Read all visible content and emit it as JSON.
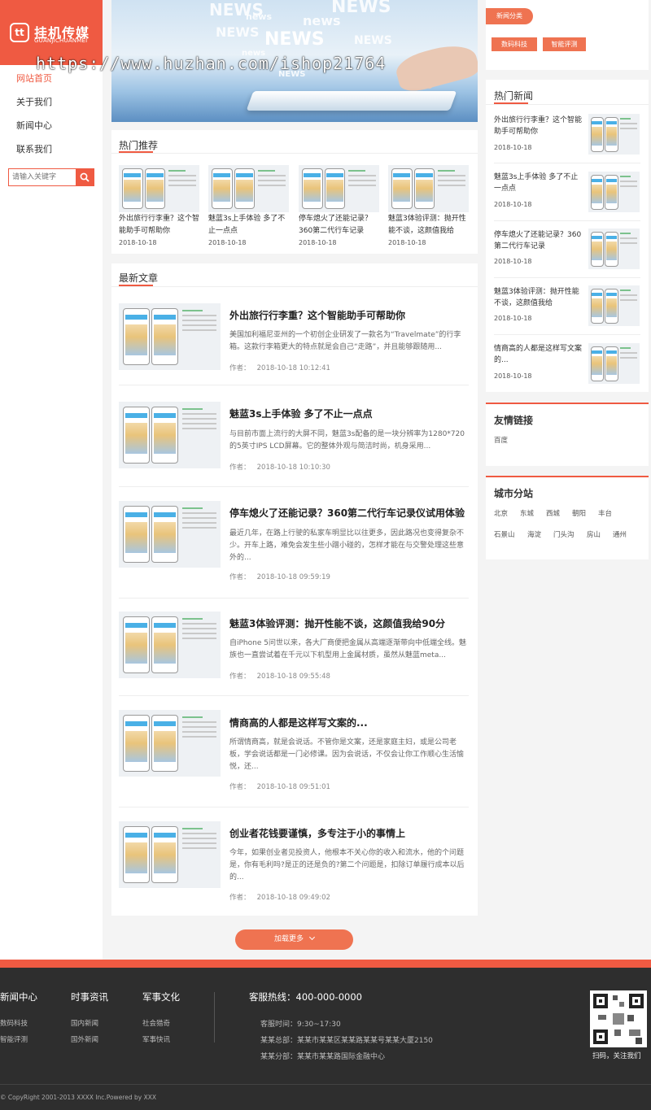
{
  "brand": {
    "name": "挂机传媒",
    "subtitle": "GUANJICHUANMEI",
    "mark": "tt"
  },
  "watermark_url": "https://www.huzhan.com/ishop21764",
  "nav": [
    {
      "label": "网站首页",
      "active": true
    },
    {
      "label": "关于我们",
      "active": false
    },
    {
      "label": "新闻中心",
      "active": false
    },
    {
      "label": "联系我们",
      "active": false
    }
  ],
  "search": {
    "placeholder": "请输入关键字"
  },
  "banner": {
    "words": [
      "NEWS",
      "NEWS",
      "news",
      "news",
      "NEWS",
      "NEWS",
      "NEWS",
      "news",
      "NEWS"
    ]
  },
  "hot": {
    "title": "热门推荐",
    "items": [
      {
        "title": "外出旅行行李重？这个智能助手可帮助你",
        "date": "2018-10-18"
      },
      {
        "title": "魅蓝3s上手体验 多了不止一点点",
        "date": "2018-10-18"
      },
      {
        "title": "停车熄火了还能记录？360第二代行车记录",
        "date": "2018-10-18"
      },
      {
        "title": "魅蓝3体验评测：抛开性能不谈，这颜值我给",
        "date": "2018-10-18"
      }
    ]
  },
  "latest": {
    "title": "最新文章",
    "meta_prefix": "作者：",
    "articles": [
      {
        "title": "外出旅行行李重？这个智能助手可帮助你",
        "excerpt": "美国加利福尼亚州的一个初创企业研发了一款名为“Travelmate”的行李箱。这款行李箱更大的特点就是会自己“走路”，并且能够跟随用...",
        "date": "2018-10-18 10:12:41"
      },
      {
        "title": "魅蓝3s上手体验 多了不止一点点",
        "excerpt": "与目前市面上流行的大屏不同，魅蓝3s配备的是一块分辨率为1280*720的5英寸IPS LCD屏幕。它的整体外观与简洁时尚，机身采用...",
        "date": "2018-10-18 10:10:30"
      },
      {
        "title": "停车熄火了还能记录？360第二代行车记录仪试用体验",
        "excerpt": "最近几年，在路上行驶的私家车明显比以往更多，因此路况也变得复杂不少。开车上路，难免会发生些小蹭小碰的，怎样才能在与交警处理这些意外的...",
        "date": "2018-10-18 09:59:19"
      },
      {
        "title": "魅蓝3体验评测：抛开性能不谈，这颜值我给90分",
        "excerpt": "自iPhone 5问世以来，各大厂商便把金属从高端逐渐带向中低端全线。魅族也一直尝试着在千元以下机型用上金属材质，虽然从魅蓝meta...",
        "date": "2018-10-18 09:55:48"
      },
      {
        "title": "情商高的人都是这样写文案的...",
        "excerpt": "所谓情商高，就是会说话。不管你是文案，还是家庭主妇，或是公司老板，学会说话都是一门必修课。因为会说话，不仅会让你工作顺心生活愉悦，还...",
        "date": "2018-10-18 09:51:01"
      },
      {
        "title": "创业者花钱要谨慎，多专注于小的事情上",
        "excerpt": "今年，如果创业者见投资人，他根本不关心你的收入和流水，他的个问题是，你有毛利吗?是正的还是负的?第二个问题是，扣除订单履行成本以后的...",
        "date": "2018-10-18 09:49:02"
      }
    ],
    "load_more": "加载更多"
  },
  "categories": {
    "title": "新闻分类",
    "tags": [
      "数码科技",
      "智能评测"
    ]
  },
  "hot_news": {
    "title": "热门新闻",
    "items": [
      {
        "title": "外出旅行行李重？这个智能助手可帮助你",
        "date": "2018-10-18"
      },
      {
        "title": "魅蓝3s上手体验 多了不止一点点",
        "date": "2018-10-18"
      },
      {
        "title": "停车熄火了还能记录？360第二代行车记录",
        "date": "2018-10-18"
      },
      {
        "title": "魅蓝3体验评测：抛开性能不谈，这颜值我给",
        "date": "2018-10-18"
      },
      {
        "title": "情商高的人都是这样写文案的...",
        "date": "2018-10-18"
      }
    ]
  },
  "links": {
    "title": "友情链接",
    "items": [
      "百度"
    ]
  },
  "cities": {
    "title": "城市分站",
    "items": [
      "北京",
      "东城",
      "西城",
      "朝阳",
      "丰台",
      "石景山",
      "海淀",
      "门头沟",
      "房山",
      "通州"
    ]
  },
  "footer": {
    "columns": [
      {
        "title": "新闻中心",
        "links": [
          "数码科技",
          "智能评测"
        ]
      },
      {
        "title": "时事资讯",
        "links": [
          "国内新闻",
          "国外新闻"
        ]
      },
      {
        "title": "军事文化",
        "links": [
          "社会猎奇",
          "军事快讯"
        ]
      }
    ],
    "hotline": "客服热线：400-000-0000",
    "hours": "客服时间：9:30~17:30",
    "hq": "某某总部：某某市某某区某某路某某号某某大厦2150",
    "branch": "某某分部：某某市某某路国际金融中心",
    "qr_caption": "扫码，关注我们",
    "copyright": "© CopyRight 2001-2013 XXXX Inc.Powered by XXX"
  },
  "colors": {
    "accent": "#ef5a42",
    "button": "#ef7351",
    "footer_bg": "#2e2e2e"
  }
}
